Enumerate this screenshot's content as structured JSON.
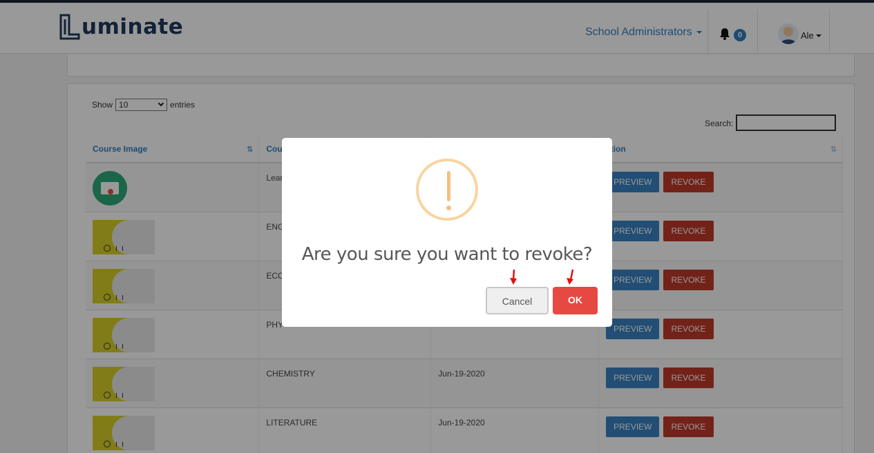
{
  "header": {
    "logo_text": "uminate",
    "role_menu": "School Administrators",
    "notification_count": "0",
    "user_name": "Ale"
  },
  "table_controls": {
    "show_label": "Show",
    "entries_value": "10",
    "entries_label": "entries",
    "search_label": "Search:"
  },
  "table": {
    "columns": [
      "Course Image",
      "Cou",
      "",
      "ction"
    ],
    "rows": [
      {
        "name": "Lear",
        "date": "",
        "preview": "PREVIEW",
        "revoke": "REVOKE"
      },
      {
        "name": "ENG",
        "date": "",
        "preview": "PREVIEW",
        "revoke": "REVOKE"
      },
      {
        "name": "ECO",
        "date": "",
        "preview": "PREVIEW",
        "revoke": "REVOKE"
      },
      {
        "name": "PHY",
        "date": "",
        "preview": "PREVIEW",
        "revoke": "REVOKE"
      },
      {
        "name": "CHEMISTRY",
        "date": "Jun-19-2020",
        "preview": "PREVIEW",
        "revoke": "REVOKE"
      },
      {
        "name": "LITERATURE",
        "date": "Jun-19-2020",
        "preview": "PREVIEW",
        "revoke": "REVOKE"
      }
    ]
  },
  "modal": {
    "title": "Are you sure you want to revoke?",
    "cancel_label": "Cancel",
    "ok_label": "OK"
  },
  "colors": {
    "brand": "#1e3a5f",
    "link": "#2f7fc1",
    "preview": "#3a82c4",
    "revoke": "#c0392b",
    "ok": "#e64942",
    "warning": "#f8d4a0"
  }
}
